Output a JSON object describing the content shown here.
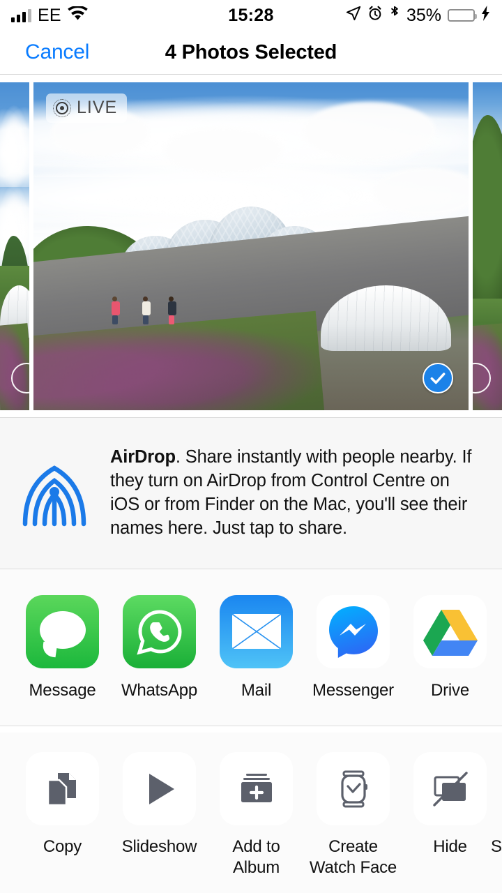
{
  "status_bar": {
    "carrier": "EE",
    "signal_bars_filled": 3,
    "signal_bars_total": 4,
    "wifi_icon": "wifi-icon",
    "time": "15:28",
    "location_icon": "location-arrow-icon",
    "alarm_icon": "alarm-clock-icon",
    "bluetooth_icon": "bluetooth-icon",
    "battery_percent": "35%",
    "battery_level": 35,
    "battery_color": "#fecb2e",
    "charging_icon": "lightning-bolt-icon"
  },
  "nav_bar": {
    "cancel_label": "Cancel",
    "cancel_color": "#0a7cff",
    "title": "4 Photos Selected"
  },
  "photo_strip": {
    "selected_count": 4,
    "live_badge": {
      "label": "LIVE",
      "icon": "live-photo-icon"
    },
    "selected_badge_icon": "checkmark-circle-icon",
    "selected_badge_color": "#1b82e8",
    "thumbnails": [
      {
        "position": "left-partial",
        "selected": false,
        "alt": "Eden Project biome partial"
      },
      {
        "position": "center",
        "selected": true,
        "live": true,
        "alt": "Eden Project biomes with family walking on path"
      },
      {
        "position": "right-partial",
        "selected": false,
        "alt": "Green foliage partial"
      }
    ]
  },
  "airdrop": {
    "icon": "airdrop-icon",
    "icon_color": "#1b7ae8",
    "title": "AirDrop",
    "body": ". Share instantly with people nearby. If they turn on AirDrop from Control Centre on iOS or from Finder on the Mac, you'll see their names here. Just tap to share."
  },
  "apps": [
    {
      "label": "Message",
      "icon": "messages-app-icon"
    },
    {
      "label": "WhatsApp",
      "icon": "whatsapp-app-icon"
    },
    {
      "label": "Mail",
      "icon": "mail-app-icon"
    },
    {
      "label": "Messenger",
      "icon": "messenger-app-icon"
    },
    {
      "label": "Drive",
      "icon": "google-drive-app-icon"
    }
  ],
  "actions": [
    {
      "label": "Copy",
      "icon": "copy-icon"
    },
    {
      "label": "Slideshow",
      "icon": "play-triangle-icon"
    },
    {
      "label": "Add to Album",
      "icon": "add-to-album-icon"
    },
    {
      "label": "Create Watch Face",
      "icon": "apple-watch-icon"
    },
    {
      "label": "Hide",
      "icon": "hide-photo-icon"
    }
  ],
  "action_cut_off_label": "S"
}
